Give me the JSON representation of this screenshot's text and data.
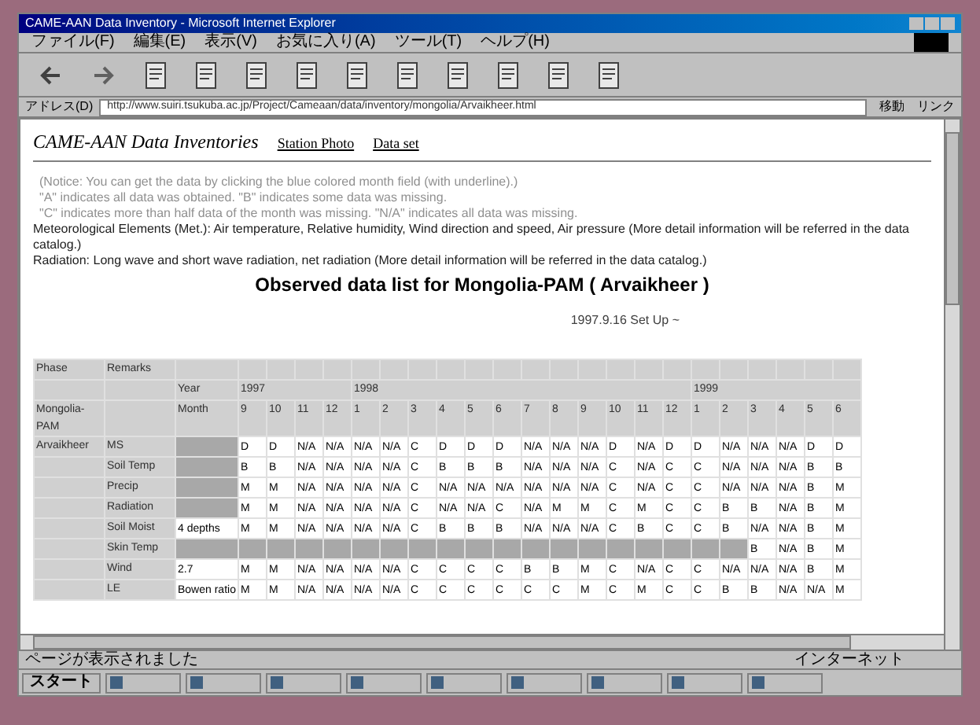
{
  "window": {
    "title": "CAME-AAN Data Inventory - Microsoft Internet Explorer"
  },
  "menu": [
    "ファイル(F)",
    "編集(E)",
    "表示(V)",
    "お気に入り(A)",
    "ツール(T)",
    "ヘルプ(H)"
  ],
  "address_bar": {
    "label": "アドレス(D)",
    "value": "http://www.suiri.tsukuba.ac.jp/Project/Cameaan/data/inventory/mongolia/Arvaikheer.html",
    "go": "移動",
    "links": "リンク"
  },
  "page": {
    "site_title": "CAME-AAN Data Inventories",
    "links": [
      "Station Photo",
      "Data set"
    ],
    "notes": [
      {
        "text": "(Notice: You can get the data by clicking the blue colored month field (with underline).)",
        "muted": true
      },
      {
        "text": "\"A\" indicates all data was obtained. \"B\" indicates some data was missing.",
        "muted": true
      },
      {
        "text": "\"C\" indicates more than half data of the month was missing. \"N/A\" indicates all data was missing.",
        "muted": true
      },
      {
        "text": "Meteorological Elements (Met.): Air temperature, Relative humidity, Wind direction and speed, Air pressure (More detail information will be referred in the data catalog.)",
        "muted": false
      },
      {
        "text": "Radiation: Long wave and short wave radiation, net radiation (More detail information will be referred in the data catalog.)",
        "muted": false
      }
    ],
    "heading": "Observed data list for Mongolia-PAM ( Arvaikheer )",
    "setup": "1997.9.16 Set Up ~"
  },
  "table": {
    "phase_label": "Phase",
    "remarks_label": "Remarks",
    "year_label": "Year",
    "month_label": "Month",
    "station": "Mongolia-PAM",
    "site": "Arvaikheer",
    "years": [
      {
        "label": "1997",
        "months": [
          "9",
          "10",
          "11",
          "12"
        ]
      },
      {
        "label": "1998",
        "months": [
          "1",
          "2",
          "3",
          "4",
          "5",
          "6",
          "7",
          "8",
          "9",
          "10",
          "11",
          "12"
        ]
      },
      {
        "label": "1999",
        "months": [
          "1",
          "2",
          "3",
          "4",
          "5",
          "6"
        ]
      }
    ],
    "rows": [
      {
        "name": "MS",
        "cells": [
          "D",
          "D",
          "N/A",
          "N/A",
          "N/A",
          "N/A",
          "C",
          "D",
          "D",
          "D",
          "N/A",
          "N/A",
          "N/A",
          "D",
          "N/A",
          "D",
          "D",
          "N/A",
          "N/A",
          "N/A",
          "D",
          "D"
        ]
      },
      {
        "name": "Soil Temp",
        "cells": [
          "B",
          "B",
          "N/A",
          "N/A",
          "N/A",
          "N/A",
          "C",
          "B",
          "B",
          "B",
          "N/A",
          "N/A",
          "N/A",
          "C",
          "N/A",
          "C",
          "C",
          "N/A",
          "N/A",
          "N/A",
          "B",
          "B"
        ]
      },
      {
        "name": "Precip",
        "cells": [
          "M",
          "M",
          "N/A",
          "N/A",
          "N/A",
          "N/A",
          "C",
          "N/A",
          "N/A",
          "N/A",
          "N/A",
          "N/A",
          "N/A",
          "C",
          "N/A",
          "C",
          "C",
          "N/A",
          "N/A",
          "N/A",
          "B",
          "M"
        ]
      },
      {
        "name": "Radiation",
        "cells": [
          "M",
          "M",
          "N/A",
          "N/A",
          "N/A",
          "N/A",
          "C",
          "N/A",
          "N/A",
          "C",
          "N/A",
          "M",
          "M",
          "C",
          "M",
          "C",
          "C",
          "B",
          "B",
          "N/A",
          "B",
          "M"
        ]
      },
      {
        "name": "Soil Moist",
        "remarks": "4 depths",
        "cells": [
          "M",
          "M",
          "N/A",
          "N/A",
          "N/A",
          "N/A",
          "C",
          "B",
          "B",
          "B",
          "N/A",
          "N/A",
          "N/A",
          "C",
          "B",
          "C",
          "C",
          "B",
          "N/A",
          "N/A",
          "B",
          "M"
        ]
      },
      {
        "name": "Skin Temp",
        "cells": [
          null,
          null,
          null,
          null,
          null,
          null,
          null,
          null,
          null,
          null,
          null,
          null,
          null,
          null,
          null,
          null,
          null,
          null,
          "B",
          "N/A",
          "B",
          "M"
        ]
      },
      {
        "name": "Wind",
        "remarks": "2.7",
        "cells": [
          "M",
          "M",
          "N/A",
          "N/A",
          "N/A",
          "N/A",
          "C",
          "C",
          "C",
          "C",
          "B",
          "B",
          "M",
          "C",
          "N/A",
          "C",
          "C",
          "N/A",
          "N/A",
          "N/A",
          "B",
          "M"
        ]
      },
      {
        "name": "LE",
        "remarks": "Bowen ratio",
        "cells": [
          "M",
          "M",
          "N/A",
          "N/A",
          "N/A",
          "N/A",
          "C",
          "C",
          "C",
          "C",
          "C",
          "C",
          "M",
          "C",
          "M",
          "C",
          "C",
          "B",
          "B",
          "N/A",
          "N/A",
          "M"
        ]
      }
    ]
  },
  "status_bar": {
    "left": "ページが表示されました",
    "zone": "インターネット"
  },
  "taskbar": {
    "start": "スタート"
  }
}
